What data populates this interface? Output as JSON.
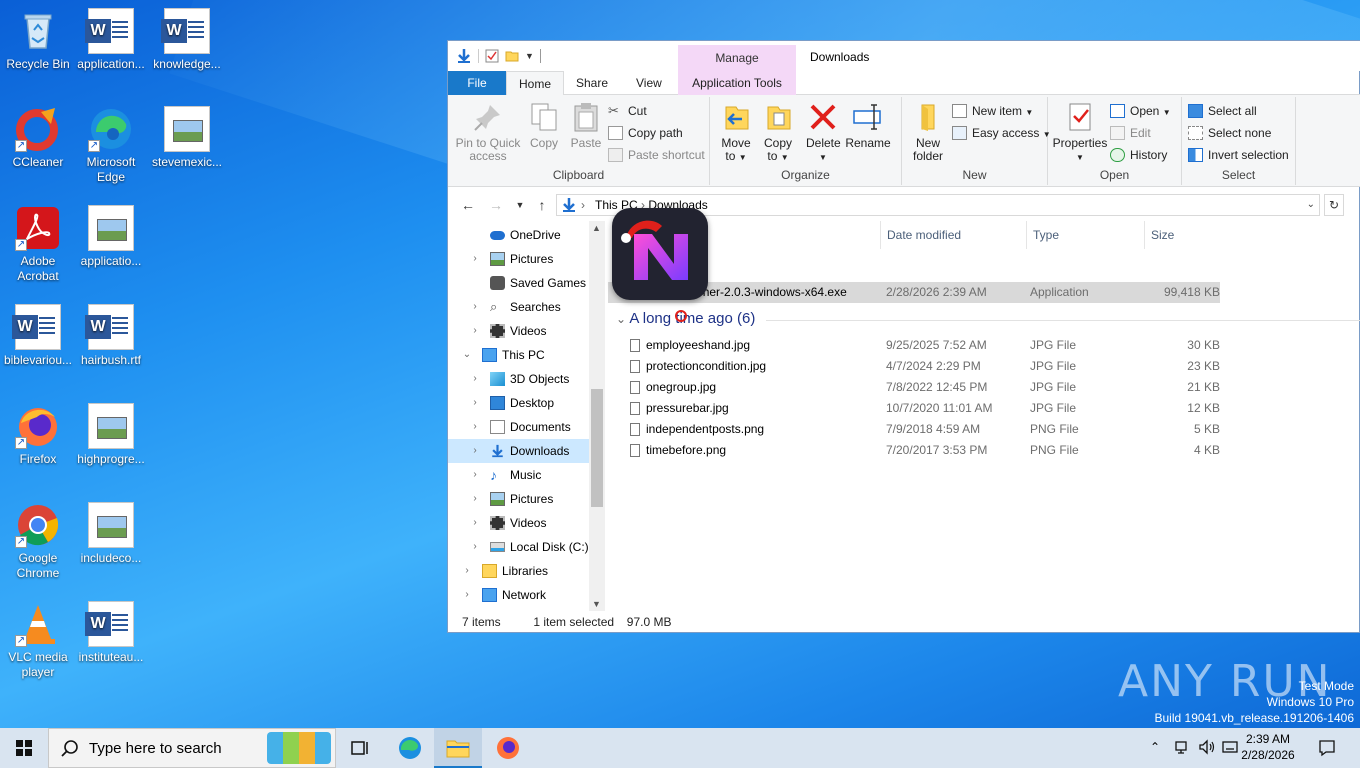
{
  "desktop": {
    "icons": [
      {
        "label": "Recycle Bin"
      },
      {
        "label": "application..."
      },
      {
        "label": "knowledge..."
      },
      {
        "label": "CCleaner"
      },
      {
        "label": "Microsoft Edge"
      },
      {
        "label": "stevemexic..."
      },
      {
        "label": "Adobe Acrobat"
      },
      {
        "label": "applicatio..."
      },
      {
        "label": "biblevariou..."
      },
      {
        "label": "hairbush.rtf"
      },
      {
        "label": "Firefox"
      },
      {
        "label": "highprogre..."
      },
      {
        "label": "Google Chrome"
      },
      {
        "label": "includeco..."
      },
      {
        "label": "VLC media player"
      },
      {
        "label": "instituteau..."
      }
    ]
  },
  "explorer": {
    "title": "Downloads",
    "context_tab": "Manage",
    "tabs": {
      "file": "File",
      "home": "Home",
      "share": "Share",
      "view": "View",
      "app_tools": "Application Tools"
    },
    "ribbon": {
      "clipboard": {
        "label": "Clipboard",
        "pin": "Pin to Quick access",
        "copy": "Copy",
        "paste": "Paste",
        "cut": "Cut",
        "copy_path": "Copy path",
        "paste_shortcut": "Paste shortcut"
      },
      "organize": {
        "label": "Organize",
        "move_to": "Move to",
        "copy_to": "Copy to",
        "delete": "Delete",
        "rename": "Rename"
      },
      "new": {
        "label": "New",
        "new_folder": "New folder",
        "new_item": "New item",
        "easy_access": "Easy access"
      },
      "open": {
        "label": "Open",
        "properties": "Properties",
        "open": "Open",
        "edit": "Edit",
        "history": "History"
      },
      "select": {
        "label": "Select",
        "select_all": "Select all",
        "select_none": "Select none",
        "invert": "Invert selection"
      }
    },
    "address": {
      "this_pc": "This PC",
      "current": "Downloads"
    },
    "nav": [
      {
        "label": "OneDrive"
      },
      {
        "label": "Pictures"
      },
      {
        "label": "Saved Games"
      },
      {
        "label": "Searches"
      },
      {
        "label": "Videos"
      },
      {
        "label": "This PC"
      },
      {
        "label": "3D Objects"
      },
      {
        "label": "Desktop"
      },
      {
        "label": "Documents"
      },
      {
        "label": "Downloads"
      },
      {
        "label": "Music"
      },
      {
        "label": "Pictures"
      },
      {
        "label": "Videos"
      },
      {
        "label": "Local Disk (C:)"
      },
      {
        "label": "Libraries"
      },
      {
        "label": "Network"
      }
    ],
    "columns": {
      "date": "Date modified",
      "type": "Type",
      "size": "Size"
    },
    "selected_file": {
      "name": "NewLauncher-2.0.3-windows-x64.exe",
      "date": "2/28/2026 2:39 AM",
      "type": "Application",
      "size": "99,418 KB"
    },
    "group_long_ago": "A long time ago (6)",
    "files": [
      {
        "name": "employeeshand.jpg",
        "date": "9/25/2025 7:52 AM",
        "type": "JPG File",
        "size": "30 KB"
      },
      {
        "name": "protectioncondition.jpg",
        "date": "4/7/2024 2:29 PM",
        "type": "JPG File",
        "size": "23 KB"
      },
      {
        "name": "onegroup.jpg",
        "date": "7/8/2022 12:45 PM",
        "type": "JPG File",
        "size": "21 KB"
      },
      {
        "name": "pressurebar.jpg",
        "date": "10/7/2020 11:01 AM",
        "type": "JPG File",
        "size": "12 KB"
      },
      {
        "name": "independentposts.png",
        "date": "7/9/2018 4:59 AM",
        "type": "PNG File",
        "size": "5 KB"
      },
      {
        "name": "timebefore.png",
        "date": "7/20/2017 3:53 PM",
        "type": "PNG File",
        "size": "4 KB"
      }
    ],
    "status": {
      "items": "7 items",
      "selected": "1 item selected",
      "size": "97.0 MB"
    }
  },
  "taskbar": {
    "search_placeholder": "Type here to search",
    "time": "2:39 AM",
    "date": "2/28/2026"
  },
  "watermark": {
    "mode": "Test Mode",
    "os": "Windows 10 Pro",
    "build": "Build 19041.vb_release.191206-1406",
    "brand": "ANY RUN"
  },
  "colors": {
    "accent": "#1979ca",
    "selection": "#cce8ff",
    "manage": "#f4d8f7"
  }
}
